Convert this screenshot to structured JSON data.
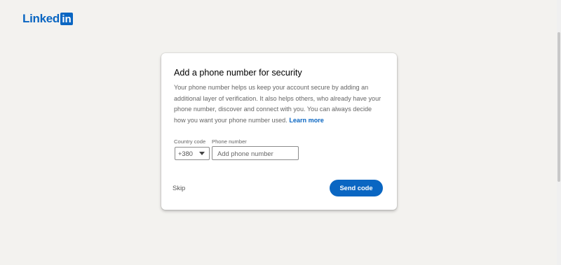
{
  "header": {
    "logo_text": "Linked",
    "logo_box_text": "in"
  },
  "card": {
    "title": "Add a phone number for security",
    "description": "Your phone number helps us keep your account secure by adding an additional layer of verification. It also helps others, who already have your phone number, discover and connect with you. You can always decide how you want your phone number used.",
    "learn_more": "Learn more",
    "country_label": "Country code",
    "phone_label": "Phone number",
    "country_value": "+380",
    "phone_value": "",
    "phone_placeholder": "Add phone number",
    "skip_label": "Skip",
    "send_label": "Send code"
  },
  "icons": {
    "logo": "linkedin-logo",
    "dropdown": "chevron-down-icon"
  },
  "colors": {
    "brand": "#0a66c2",
    "background": "#f3f2ef"
  }
}
